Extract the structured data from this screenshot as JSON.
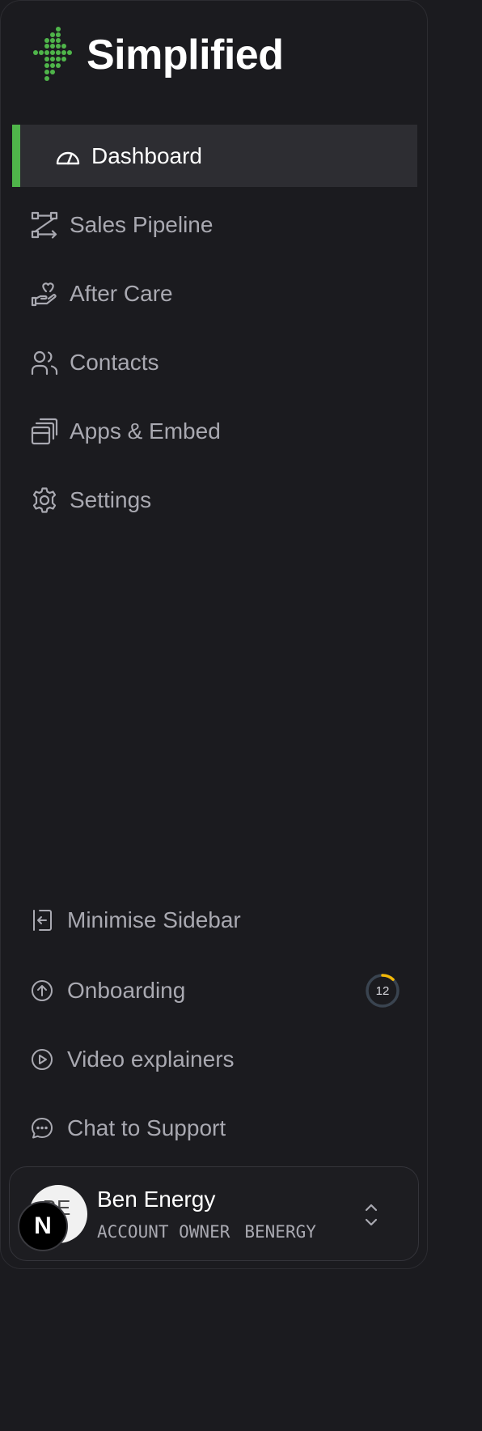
{
  "brand": {
    "name": "Simplified",
    "logo_icon": "arrow-dots-logo"
  },
  "colors": {
    "accent": "#4fb54a",
    "background": "#1b1b1f",
    "active_bg": "#2d2d32",
    "text_muted": "#a9a9b1",
    "ring": "#f2b807"
  },
  "nav": {
    "items": [
      {
        "label": "Dashboard",
        "icon": "gauge-icon",
        "active": true
      },
      {
        "label": "Sales Pipeline",
        "icon": "pipeline-icon"
      },
      {
        "label": "After Care",
        "icon": "hand-heart-icon"
      },
      {
        "label": "Contacts",
        "icon": "users-icon"
      },
      {
        "label": "Apps & Embed",
        "icon": "apps-icon"
      },
      {
        "label": "Settings",
        "icon": "gear-icon"
      }
    ]
  },
  "bottom": {
    "minimise": {
      "label": "Minimise Sidebar",
      "icon": "exit-icon"
    },
    "onboarding": {
      "label": "Onboarding",
      "icon": "arrow-up-circle-icon",
      "count": "12",
      "progress": 0.12
    },
    "video": {
      "label": "Video explainers",
      "icon": "play-circle-icon"
    },
    "chat": {
      "label": "Chat to Support",
      "icon": "chat-bubble-icon"
    }
  },
  "account": {
    "initials": "BE",
    "badge": "N",
    "name": "Ben Energy",
    "role": "ACCOUNT OWNER",
    "handle": "BENERGY",
    "switcher_icon": "chevrons-up-down-icon"
  }
}
